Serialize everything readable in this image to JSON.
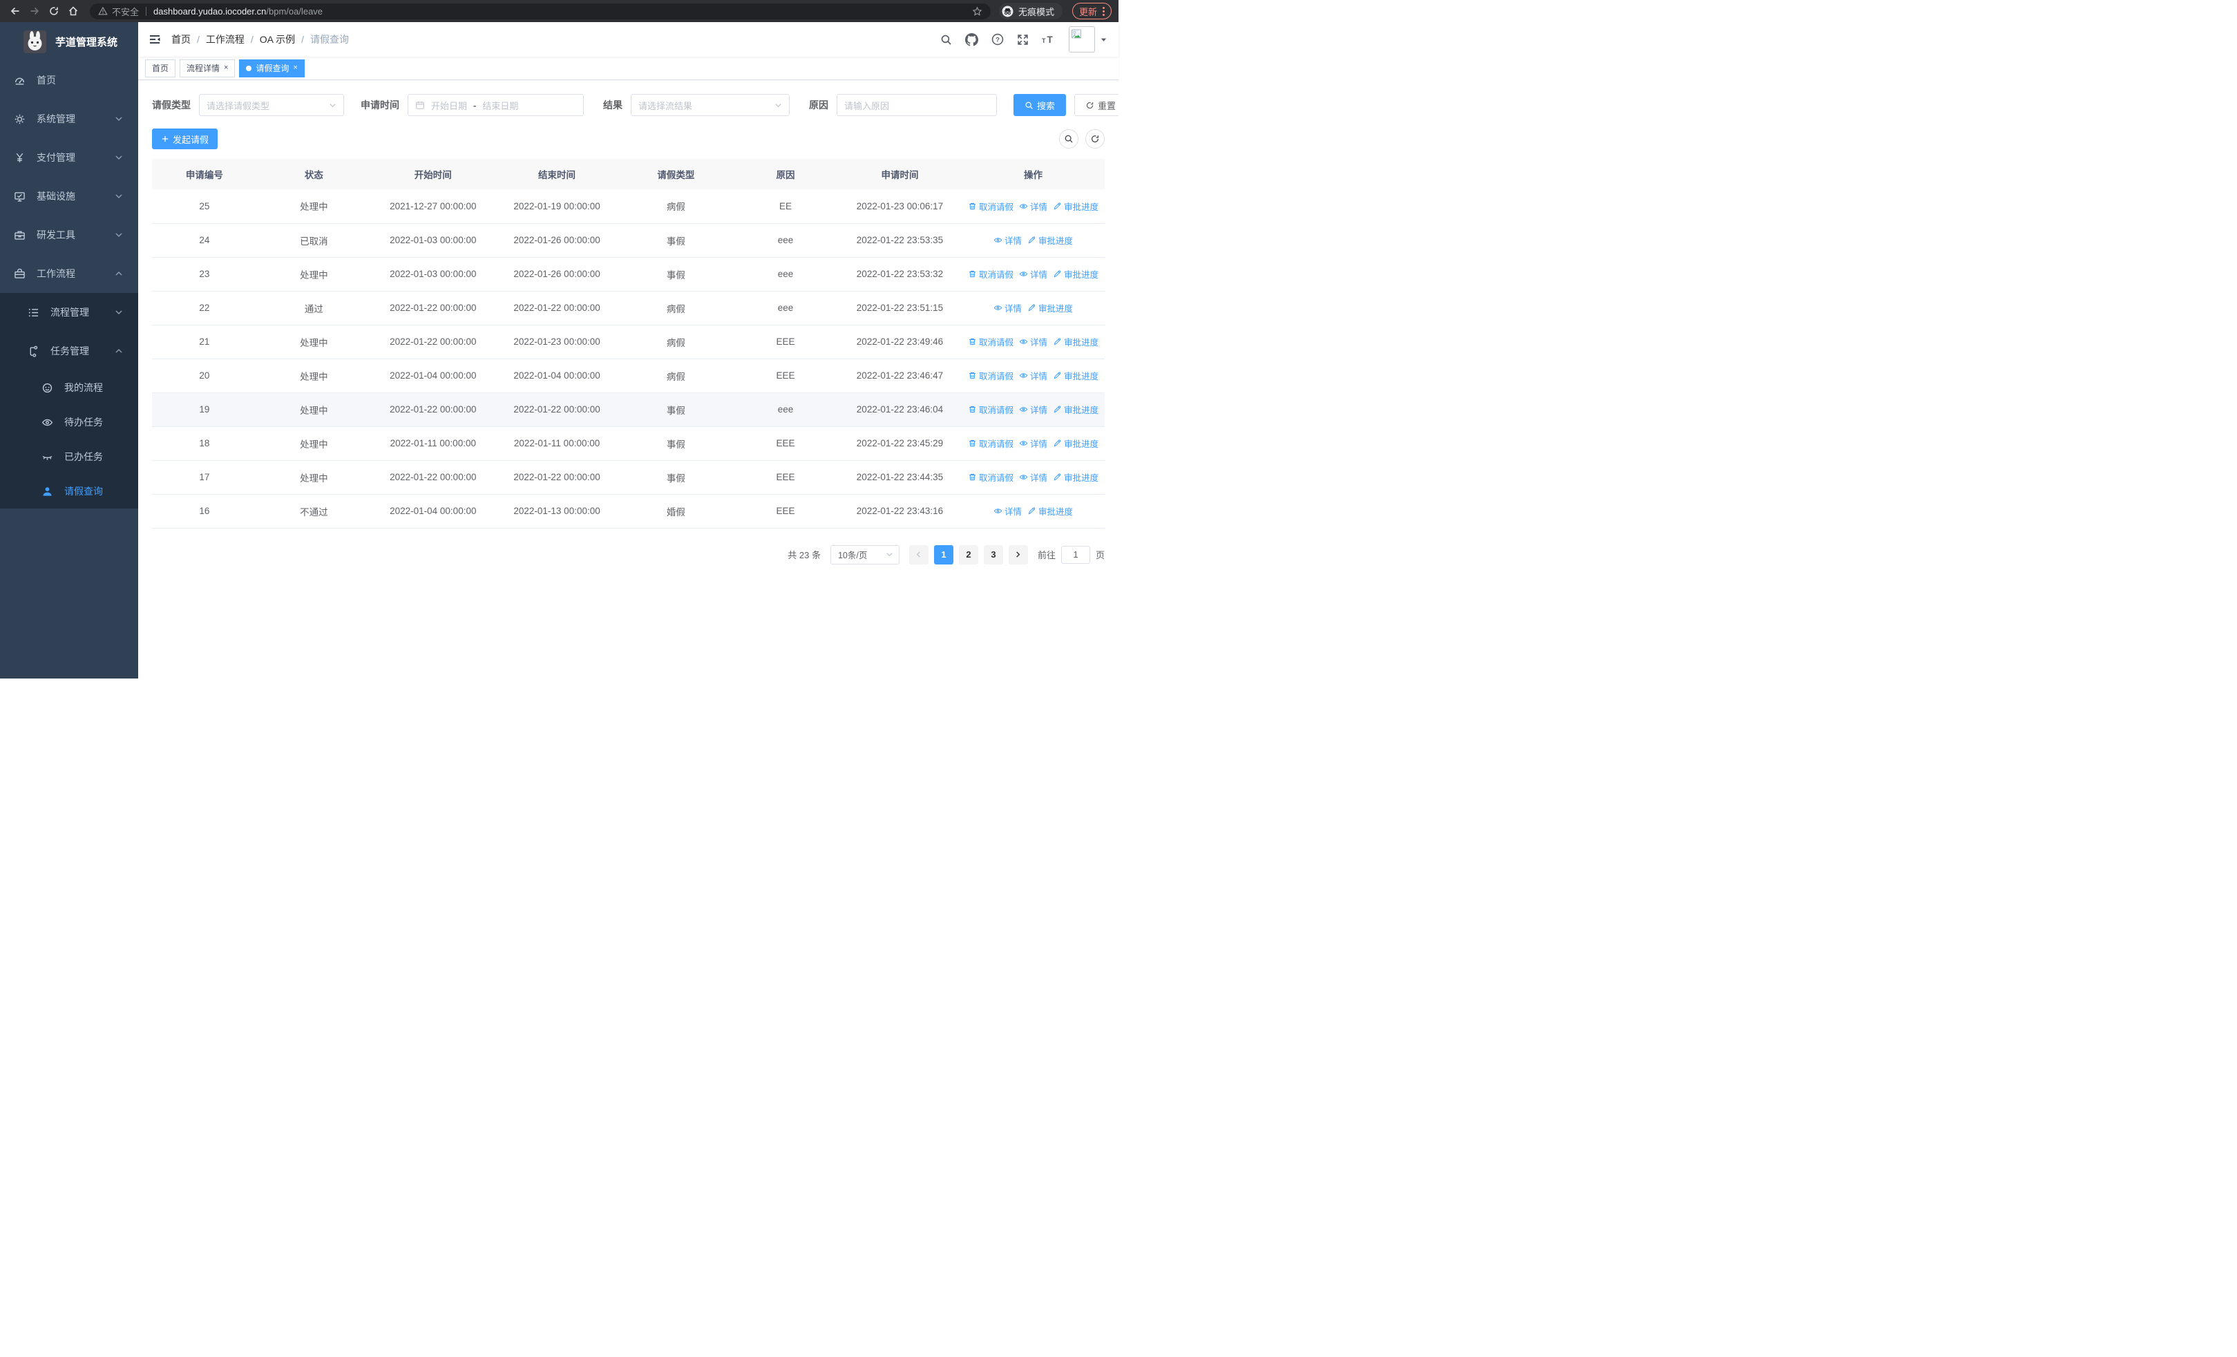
{
  "browser": {
    "security_label": "不安全",
    "url_host": "dashboard.yudao.iocoder.cn",
    "url_path": "/bpm/oa/leave",
    "incognito_label": "无痕模式",
    "update_label": "更新"
  },
  "sidebar": {
    "logo_title": "芋道管理系统",
    "items": [
      {
        "key": "home",
        "label": "首页",
        "icon": "dashboard-icon",
        "level": 1
      },
      {
        "key": "system",
        "label": "系统管理",
        "icon": "gear-icon",
        "level": 1,
        "chevron": "down"
      },
      {
        "key": "payment",
        "label": "支付管理",
        "icon": "yen-icon",
        "level": 1,
        "chevron": "down"
      },
      {
        "key": "infra",
        "label": "基础设施",
        "icon": "monitor-icon",
        "level": 1,
        "chevron": "down"
      },
      {
        "key": "devtools",
        "label": "研发工具",
        "icon": "toolbox-icon",
        "level": 1,
        "chevron": "down"
      },
      {
        "key": "workflow",
        "label": "工作流程",
        "icon": "briefcase-icon",
        "level": 1,
        "chevron": "up"
      },
      {
        "key": "process-mgmt",
        "label": "流程管理",
        "icon": "list-tree-icon",
        "level": 2,
        "chevron": "down",
        "in_submenu": true
      },
      {
        "key": "task-mgmt",
        "label": "任务管理",
        "icon": "flow-icon",
        "level": 2,
        "chevron": "up",
        "in_submenu": true
      },
      {
        "key": "my-process",
        "label": "我的流程",
        "icon": "face-icon",
        "level": 3,
        "in_submenu": true
      },
      {
        "key": "todo-tasks",
        "label": "待办任务",
        "icon": "eye-open-icon",
        "level": 3,
        "in_submenu": true
      },
      {
        "key": "done-tasks",
        "label": "已办任务",
        "icon": "eye-closed-icon",
        "level": 3,
        "in_submenu": true
      },
      {
        "key": "leave-query",
        "label": "请假查询",
        "icon": "user-icon",
        "level": 3,
        "in_submenu": true,
        "active": true
      }
    ]
  },
  "navbar": {
    "separator": "/",
    "breadcrumb": [
      {
        "label": "首页"
      },
      {
        "label": "工作流程"
      },
      {
        "label": "OA 示例"
      },
      {
        "label": "请假查询",
        "current": true
      }
    ]
  },
  "tags": [
    {
      "label": "首页"
    },
    {
      "label": "流程详情",
      "closable": true
    },
    {
      "label": "请假查询",
      "closable": true,
      "active": true
    }
  ],
  "filters": {
    "leave_type_label": "请假类型",
    "leave_type_placeholder": "请选择请假类型",
    "apply_time_label": "申请时间",
    "start_placeholder": "开始日期",
    "range_separator": "-",
    "end_placeholder": "结束日期",
    "result_label": "结果",
    "result_placeholder": "请选择流结果",
    "reason_label": "原因",
    "reason_placeholder": "请输入原因",
    "search_label": "搜索",
    "reset_label": "重置"
  },
  "toolbar": {
    "create_label": "发起请假"
  },
  "table": {
    "columns": [
      "申请编号",
      "状态",
      "开始时间",
      "结束时间",
      "请假类型",
      "原因",
      "申请时间",
      "操作"
    ],
    "action_labels": {
      "cancel": "取消请假",
      "detail": "详情",
      "progress": "审批进度"
    },
    "rows": [
      {
        "id": "25",
        "status": "处理中",
        "start": "2021-12-27 00:00:00",
        "end": "2022-01-19 00:00:00",
        "type": "病假",
        "reason": "EE",
        "apply_time": "2022-01-23 00:06:17",
        "actions": [
          "cancel",
          "detail",
          "progress"
        ]
      },
      {
        "id": "24",
        "status": "已取消",
        "start": "2022-01-03 00:00:00",
        "end": "2022-01-26 00:00:00",
        "type": "事假",
        "reason": "eee",
        "apply_time": "2022-01-22 23:53:35",
        "actions": [
          "detail",
          "progress"
        ]
      },
      {
        "id": "23",
        "status": "处理中",
        "start": "2022-01-03 00:00:00",
        "end": "2022-01-26 00:00:00",
        "type": "事假",
        "reason": "eee",
        "apply_time": "2022-01-22 23:53:32",
        "actions": [
          "cancel",
          "detail",
          "progress"
        ]
      },
      {
        "id": "22",
        "status": "通过",
        "start": "2022-01-22 00:00:00",
        "end": "2022-01-22 00:00:00",
        "type": "病假",
        "reason": "eee",
        "apply_time": "2022-01-22 23:51:15",
        "actions": [
          "detail",
          "progress"
        ]
      },
      {
        "id": "21",
        "status": "处理中",
        "start": "2022-01-22 00:00:00",
        "end": "2022-01-23 00:00:00",
        "type": "病假",
        "reason": "EEE",
        "apply_time": "2022-01-22 23:49:46",
        "actions": [
          "cancel",
          "detail",
          "progress"
        ]
      },
      {
        "id": "20",
        "status": "处理中",
        "start": "2022-01-04 00:00:00",
        "end": "2022-01-04 00:00:00",
        "type": "病假",
        "reason": "EEE",
        "apply_time": "2022-01-22 23:46:47",
        "actions": [
          "cancel",
          "detail",
          "progress"
        ]
      },
      {
        "id": "19",
        "status": "处理中",
        "start": "2022-01-22 00:00:00",
        "end": "2022-01-22 00:00:00",
        "type": "事假",
        "reason": "eee",
        "apply_time": "2022-01-22 23:46:04",
        "actions": [
          "cancel",
          "detail",
          "progress"
        ],
        "highlight": true
      },
      {
        "id": "18",
        "status": "处理中",
        "start": "2022-01-11 00:00:00",
        "end": "2022-01-11 00:00:00",
        "type": "事假",
        "reason": "EEE",
        "apply_time": "2022-01-22 23:45:29",
        "actions": [
          "cancel",
          "detail",
          "progress"
        ]
      },
      {
        "id": "17",
        "status": "处理中",
        "start": "2022-01-22 00:00:00",
        "end": "2022-01-22 00:00:00",
        "type": "事假",
        "reason": "EEE",
        "apply_time": "2022-01-22 23:44:35",
        "actions": [
          "cancel",
          "detail",
          "progress"
        ]
      },
      {
        "id": "16",
        "status": "不通过",
        "start": "2022-01-04 00:00:00",
        "end": "2022-01-13 00:00:00",
        "type": "婚假",
        "reason": "EEE",
        "apply_time": "2022-01-22 23:43:16",
        "actions": [
          "detail",
          "progress"
        ]
      }
    ]
  },
  "pagination": {
    "total_text": "共 23 条",
    "page_size": "10条/页",
    "pages": [
      "1",
      "2",
      "3"
    ],
    "active_page": "1",
    "goto_label": "前往",
    "goto_value": "1",
    "goto_suffix": "页"
  },
  "colors": {
    "accent": "#409eff",
    "sidebar_bg": "#304156",
    "submenu_bg": "#1f2d3d",
    "update_button": "#f28b82"
  }
}
